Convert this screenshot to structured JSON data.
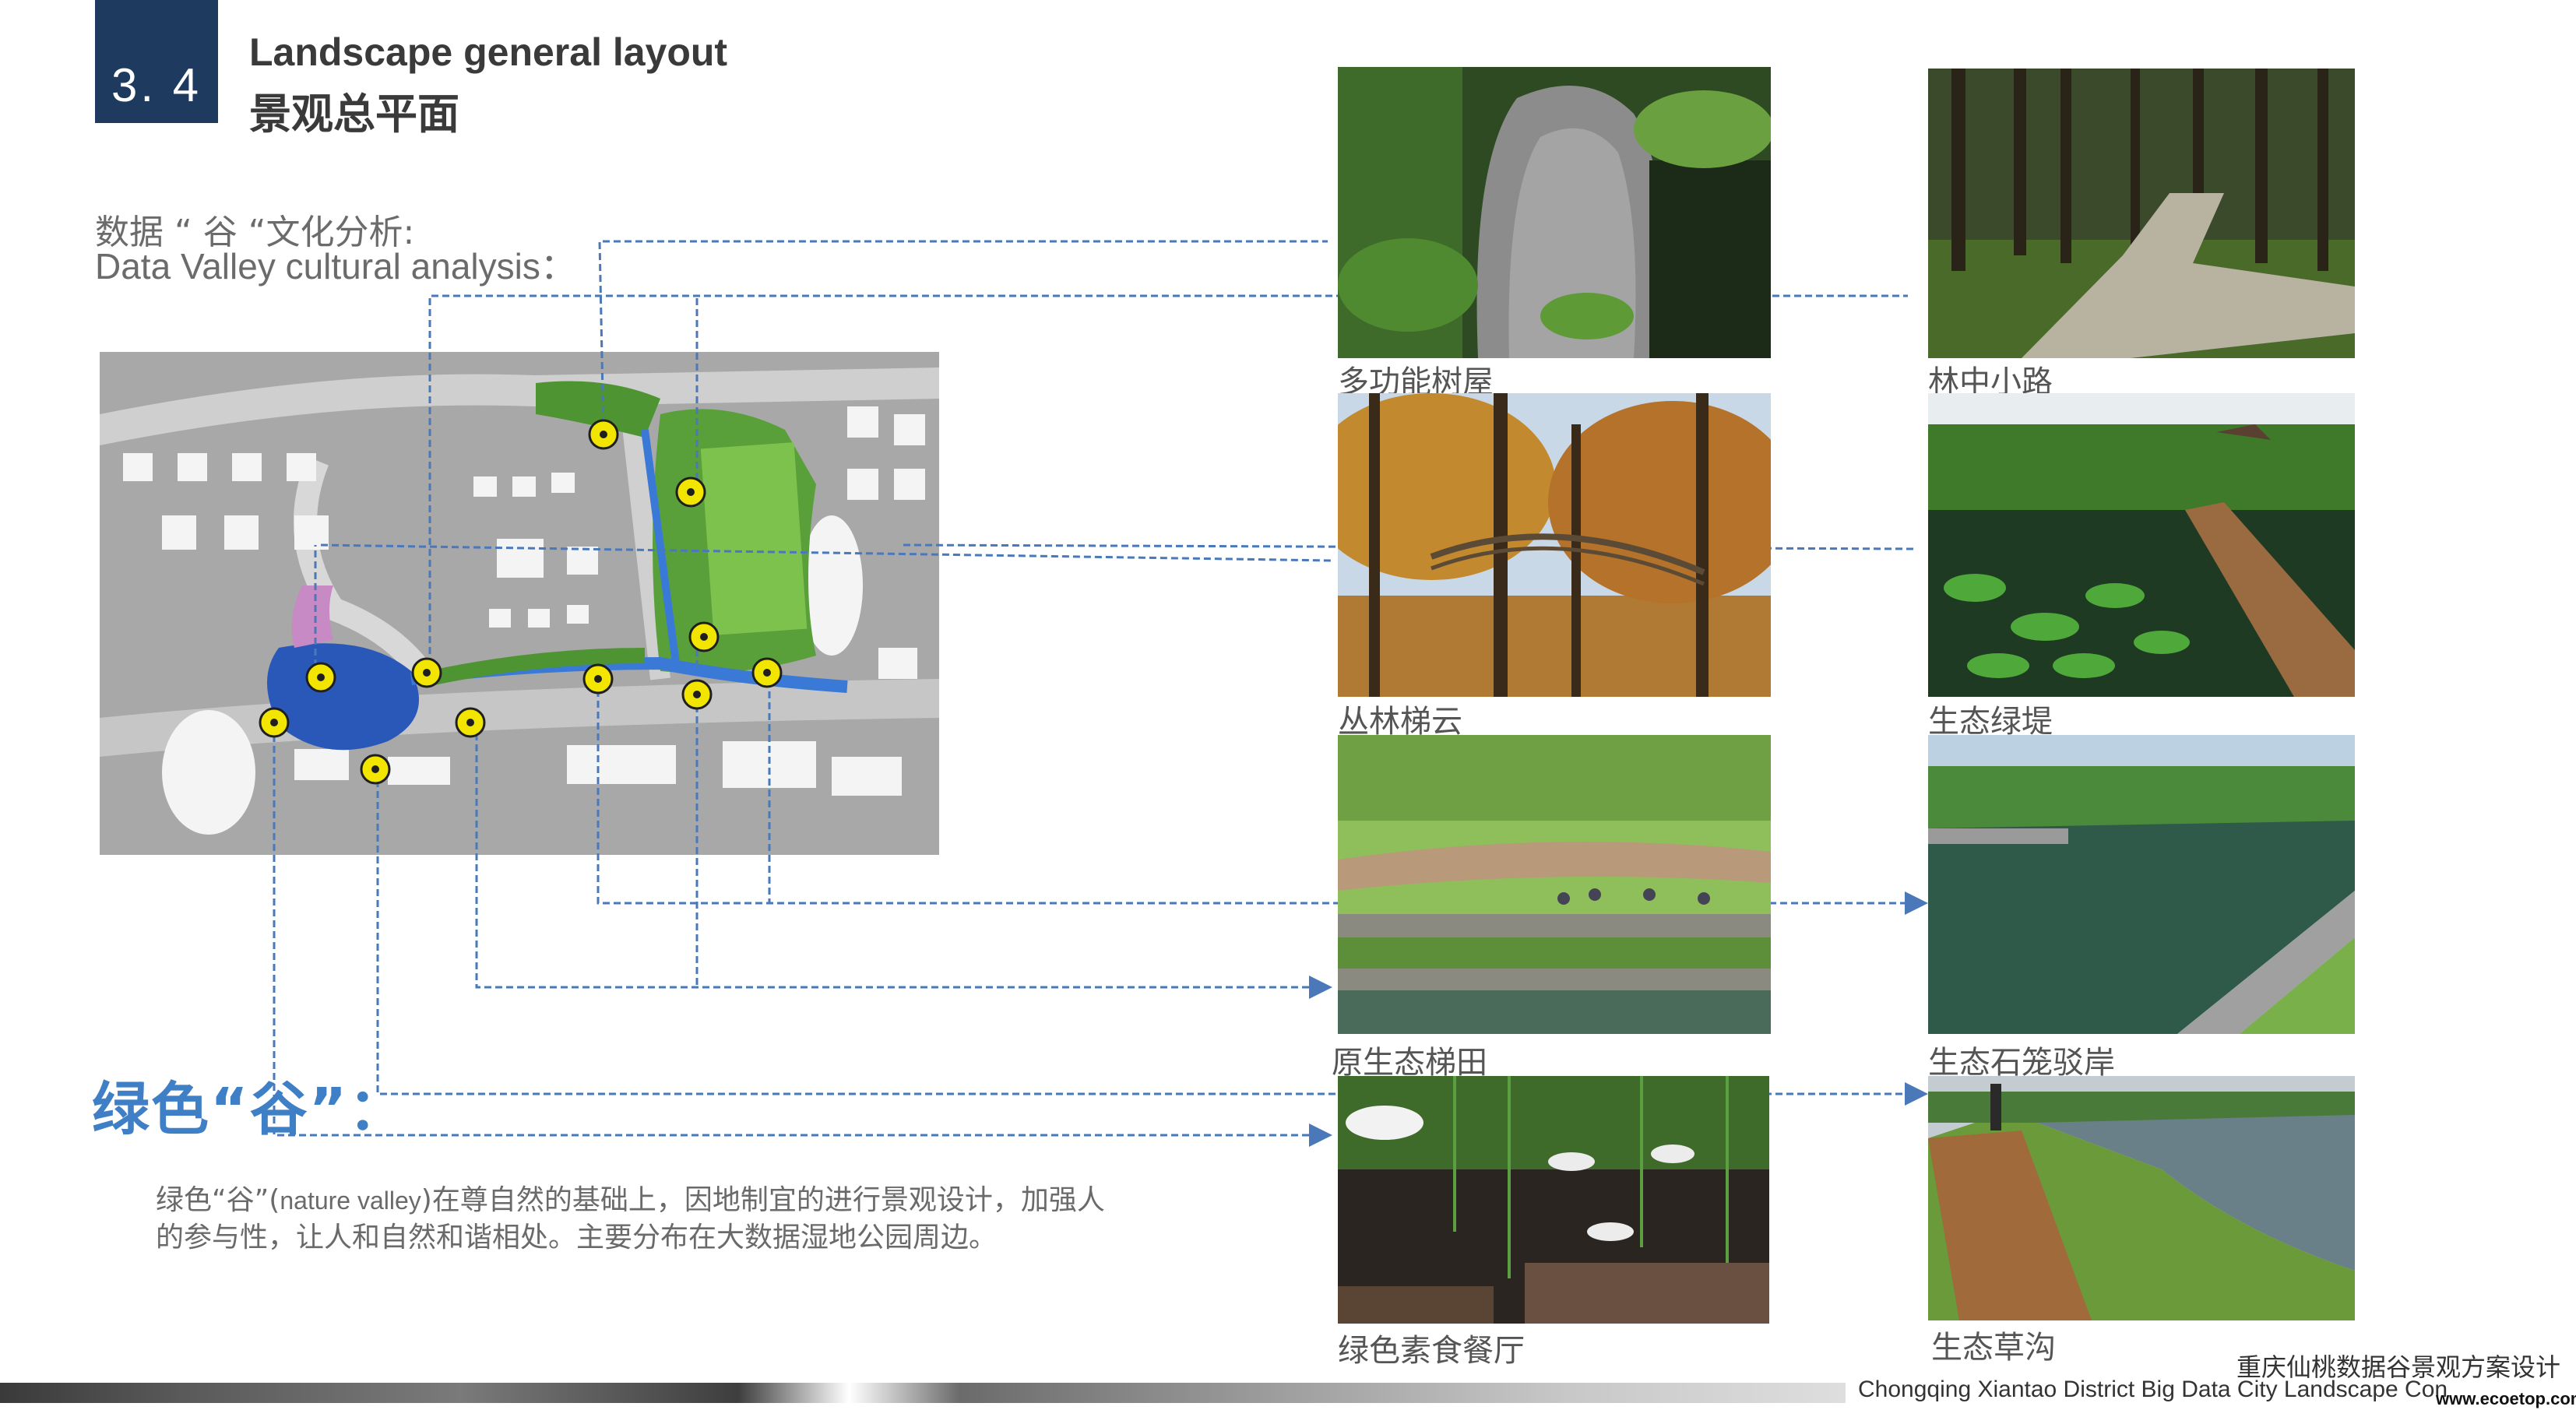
{
  "header": {
    "section_number": "3. 4",
    "title_en": "Landscape general layout",
    "title_cn": "景观总平面"
  },
  "analysis": {
    "title_cn": "数据 “ 谷 “文化分析:",
    "title_en": "Data Valley cultural analysis："
  },
  "concept": {
    "title": "绿色“谷”：",
    "desc_line1_a": "绿色“谷”(",
    "desc_line1_en": "nature  valley",
    "desc_line1_b": ")在尊自然的基础上，因地制宜的进行景观设计，加强人",
    "desc_line2": "的参与性，让人和自然和谐相处。主要分布在大数据湿地公园周边。"
  },
  "photos": [
    {
      "caption": "多功能树屋"
    },
    {
      "caption": "林中小路"
    },
    {
      "caption": "丛林梯云"
    },
    {
      "caption": "生态绿堤"
    },
    {
      "caption": "原生态梯田"
    },
    {
      "caption": "生态石笼驳岸"
    },
    {
      "caption": "绿色素食餐厅"
    },
    {
      "caption": "生态草沟"
    }
  ],
  "footer": {
    "title_cn": "重庆仙桃数据谷景观方案设计",
    "title_en": "Chongqing Xiantao District Big Data City Landscape Con",
    "watermark": "www.ecoetop.com"
  },
  "colors": {
    "accent_blue": "#3f7fc6",
    "header_navy": "#1f3a5f",
    "marker_yellow": "#f2e600",
    "leader_line": "#4a78b8"
  }
}
